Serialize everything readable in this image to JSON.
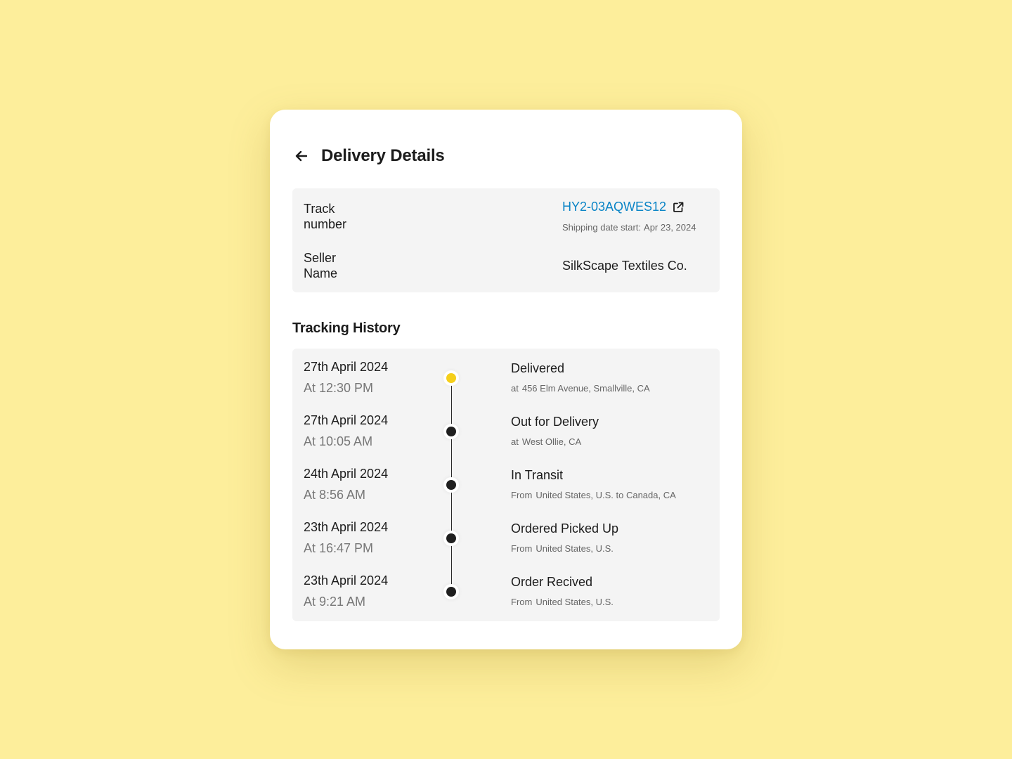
{
  "header": {
    "title": "Delivery Details",
    "back_icon": "arrow-left-icon"
  },
  "info": {
    "track_label": "Track\nnumber",
    "track_number": "HY2-03AQWES12",
    "external_link_icon": "external-link-icon",
    "shipping_label": "Shipping date start:",
    "shipping_date": "Apr 23, 2024",
    "seller_label": "Seller\nName",
    "seller_name": "SilkScape Textiles Co."
  },
  "history": {
    "title": "Tracking History",
    "events": [
      {
        "date": "27th April 2024",
        "time": "At 12:30 PM",
        "status": "Delivered",
        "loc_prefix": "at",
        "loc": "456 Elm Avenue, Smallville, CA",
        "active": true
      },
      {
        "date": "27th April 2024",
        "time": "At 10:05 AM",
        "status": "Out for Delivery",
        "loc_prefix": "at",
        "loc": "West Ollie,  CA",
        "active": false
      },
      {
        "date": "24th April 2024",
        "time": "At 8:56 AM",
        "status": "In Transit",
        "loc_prefix": "From",
        "loc": "United States, U.S. to Canada, CA",
        "active": false
      },
      {
        "date": "23th April 2024",
        "time": "At 16:47 PM",
        "status": "Ordered Picked Up",
        "loc_prefix": "From",
        "loc": "United States, U.S.",
        "active": false
      },
      {
        "date": "23th April 2024",
        "time": "At 9:21 AM",
        "status": "Order Recived",
        "loc_prefix": "From",
        "loc": "United States, U.S.",
        "active": false
      }
    ]
  },
  "colors": {
    "background": "#FDEE9B",
    "link": "#0A84C6",
    "active_dot": "#F5CF1B",
    "panel": "#F4F4F4"
  }
}
